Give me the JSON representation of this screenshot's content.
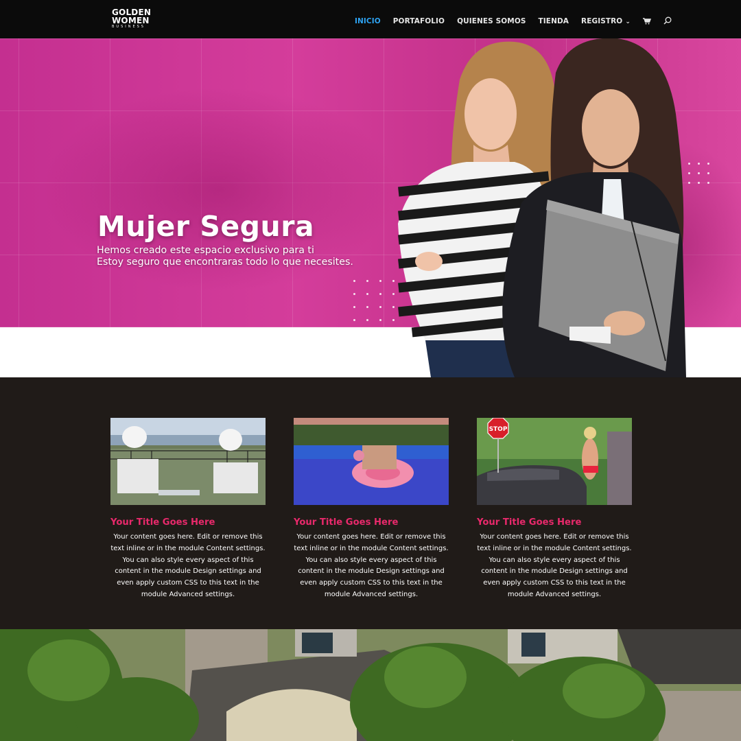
{
  "header": {
    "logo": {
      "line1": "GOLDEN",
      "line2": "WOMEN",
      "line3": "BUSINESS"
    },
    "nav": [
      {
        "label": "INICIO",
        "active": true
      },
      {
        "label": "PORTAFOLIO",
        "active": false
      },
      {
        "label": "QUIENES SOMOS",
        "active": false
      },
      {
        "label": "TIENDA",
        "active": false
      },
      {
        "label": "REGISTRO",
        "active": false,
        "dropdown": true
      }
    ],
    "icons": [
      "cart-icon",
      "search-icon"
    ]
  },
  "hero": {
    "title": "Mujer Segura",
    "subtitle_line1": "Hemos creado este espacio exclusivo para ti",
    "subtitle_line2": "Estoy seguro que encontraras todo lo que necesites."
  },
  "features": [
    {
      "title": "Your Title Goes Here",
      "body": "Your content goes here. Edit or remove this text inline or in the module Content settings. You can also style every aspect of this content in the module Design settings and even apply custom CSS to this text in the module Advanced settings."
    },
    {
      "title": "Your Title Goes Here",
      "body": "Your content goes here. Edit or remove this text inline or in the module Content settings. You can also style every aspect of this content in the module Design settings and even apply custom CSS to this text in the module Advanced settings."
    },
    {
      "title": "Your Title Goes Here",
      "body": "Your content goes here. Edit or remove this text inline or in the module Content settings. You can also style every aspect of this content in the module Design settings and even apply custom CSS to this text in the module Advanced settings."
    }
  ],
  "stop_sign": "STOP",
  "colors": {
    "accent": "#2ea3f2",
    "title": "#e8296b",
    "hero": "#c42f90",
    "dark": "#201b18"
  }
}
